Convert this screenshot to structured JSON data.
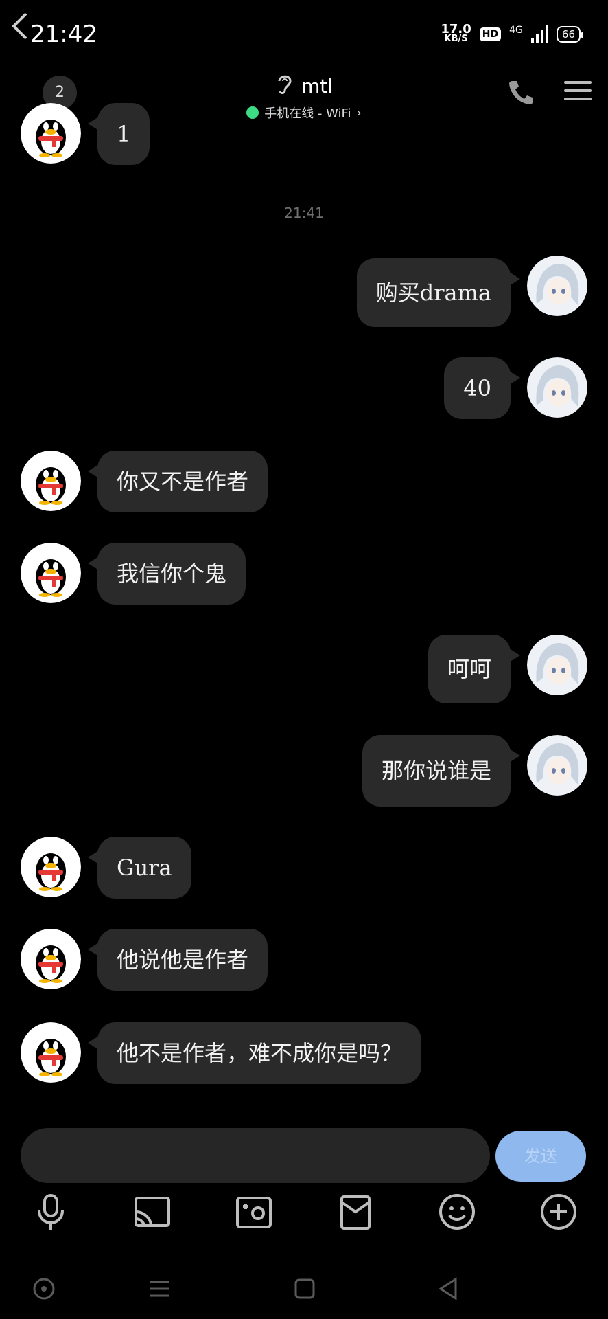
{
  "status_bar": {
    "time": "21:42",
    "net_speed_value": "17.0",
    "net_speed_unit": "KB/S",
    "hd_badge": "HD",
    "network": "4G",
    "battery": "66"
  },
  "header": {
    "back_icon": "chevron-left-icon",
    "unread_count": "2",
    "contact_name": "mtl",
    "presence_text": "手机在线 - WiFi",
    "presence_chevron": "›",
    "presence_color": "#3ddc84"
  },
  "messages": [
    {
      "side": "left",
      "text": "1"
    },
    {
      "type": "timestamp",
      "text": "21:41"
    },
    {
      "side": "right",
      "text": "购买drama"
    },
    {
      "side": "right",
      "text": "40"
    },
    {
      "side": "left",
      "text": "你又不是作者"
    },
    {
      "side": "left",
      "text": "我信你个鬼"
    },
    {
      "side": "right",
      "text": "呵呵"
    },
    {
      "side": "right",
      "text": "那你说谁是"
    },
    {
      "side": "left",
      "text": "Gura"
    },
    {
      "side": "left",
      "text": "他说他是作者"
    },
    {
      "side": "left",
      "text": "他不是作者，难不成你是吗？"
    }
  ],
  "composer": {
    "input_value": "",
    "send_label": "发送",
    "send_color": "#8fb8ef"
  },
  "toolbar": {
    "icons": [
      "microphone-icon",
      "cast-icon",
      "photo-icon",
      "package-icon",
      "emoji-icon",
      "add-icon"
    ]
  },
  "system_nav": {
    "icons": [
      "assistant-icon",
      "menu-icon",
      "home-icon",
      "back-icon"
    ]
  }
}
